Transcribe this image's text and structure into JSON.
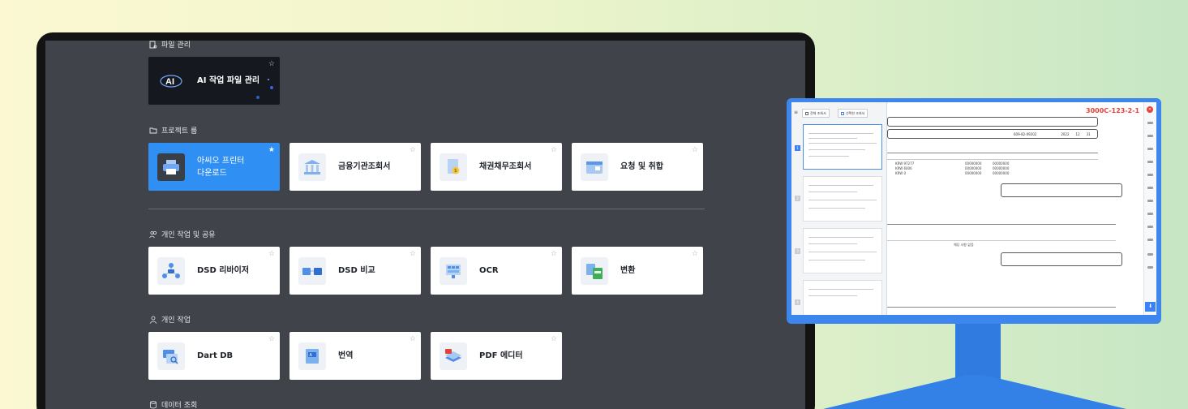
{
  "sections": {
    "file": {
      "title": "파일 관리"
    },
    "project": {
      "title": "프로젝트 룸"
    },
    "shared": {
      "title": "개인 작업 및 공유"
    },
    "personal": {
      "title": "개인 작업"
    },
    "data": {
      "title": "데이터 조회"
    }
  },
  "cards": {
    "ai": {
      "label": "AI 작업 파일 관리",
      "logo": "AI"
    },
    "print": {
      "label1": "아씨오 프린터",
      "label2": "다운로드"
    },
    "finance": {
      "label": "금융기관조회서"
    },
    "debt": {
      "label": "채권채무조회서"
    },
    "request": {
      "label": "요청 및 취합"
    },
    "dsd_review": {
      "label": "DSD 리바이저"
    },
    "dsd_compare": {
      "label": "DSD 비교"
    },
    "ocr": {
      "label": "OCR"
    },
    "convert": {
      "label": "변환"
    },
    "dartdb": {
      "label": "Dart DB"
    },
    "translate": {
      "label": "번역"
    },
    "pdf": {
      "label": "PDF 에디터"
    }
  },
  "star": "☆",
  "star_filled": "★",
  "monitor": {
    "doc_code": "3000C-123-2-1",
    "tab_all": "전체 조회서",
    "tab_selected": "선택한 조회서",
    "pages": [
      "1",
      "2",
      "3",
      "4"
    ],
    "biz_no": "609-82-09202",
    "year": "2022",
    "month": "12",
    "day": "31",
    "amount1": "KRW 97277",
    "amount2": "KRW 6006",
    "amount3": "KRW 0",
    "zeros": "00000000",
    "none": "해당 사항 없음",
    "close": "×",
    "download": "⬇"
  },
  "colors": {
    "accent": "#2f8ff2",
    "panel": "#40444a",
    "monitor": "#3d86ee"
  }
}
